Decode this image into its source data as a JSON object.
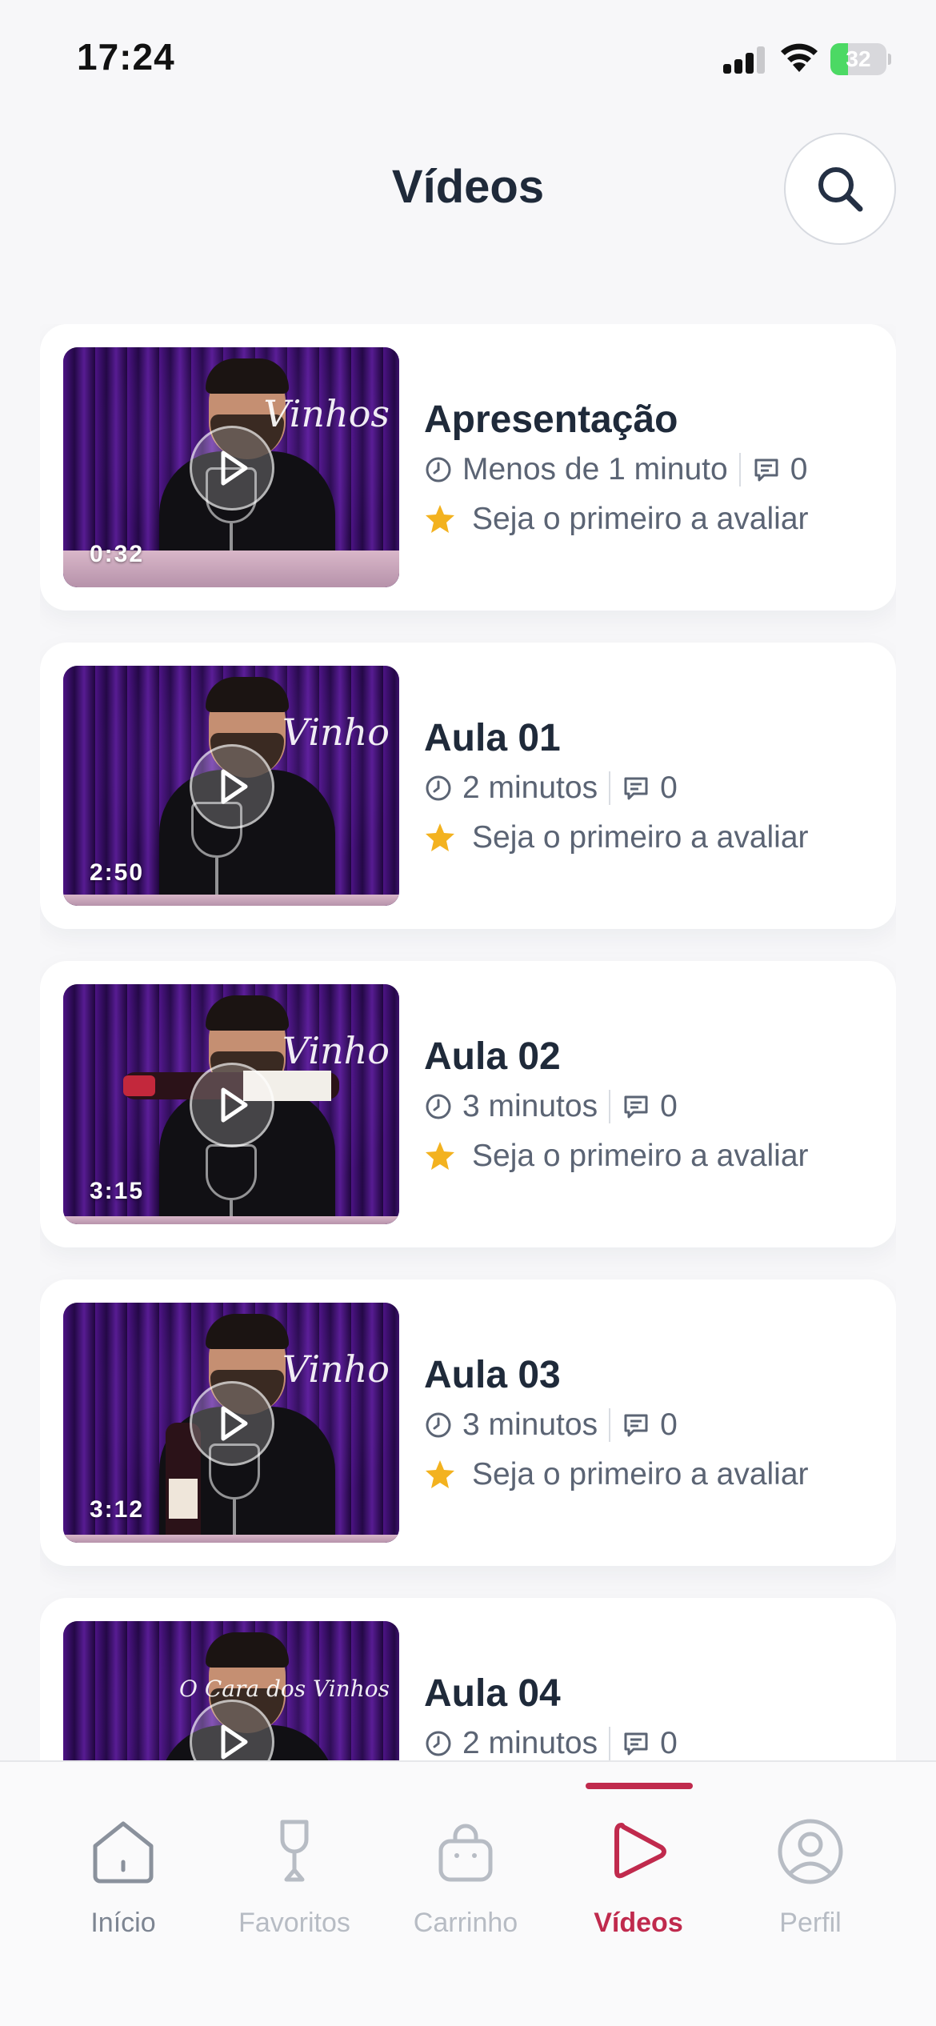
{
  "status_bar": {
    "time": "17:24",
    "battery_level": "32",
    "battery_fill_percent": 32
  },
  "header": {
    "title": "Vídeos",
    "search_icon": "search-icon"
  },
  "videos": [
    {
      "title": "Apresentação",
      "duration": "0:32",
      "length_text": "Menos de 1 minuto",
      "comments": "0",
      "rating_text": "Seja o primeiro a avaliar",
      "brand": "Vinhos"
    },
    {
      "title": "Aula 01",
      "duration": "2:50",
      "length_text": "2 minutos",
      "comments": "0",
      "rating_text": "Seja o primeiro a avaliar",
      "brand": "Vinho"
    },
    {
      "title": "Aula 02",
      "duration": "3:15",
      "length_text": "3 minutos",
      "comments": "0",
      "rating_text": "Seja o primeiro a avaliar",
      "brand": "Vinho"
    },
    {
      "title": "Aula 03",
      "duration": "3:12",
      "length_text": "3 minutos",
      "comments": "0",
      "rating_text": "Seja o primeiro a avaliar",
      "brand": "Vinho"
    },
    {
      "title": "Aula 04",
      "duration": "",
      "length_text": "2 minutos",
      "comments": "0",
      "rating_text": "",
      "brand": "O Cara dos Vinhos"
    }
  ],
  "tab_bar": {
    "tabs": [
      {
        "label": "Início",
        "icon": "home-icon"
      },
      {
        "label": "Favoritos",
        "icon": "wine-glass-icon"
      },
      {
        "label": "Carrinho",
        "icon": "bag-icon"
      },
      {
        "label": "Vídeos",
        "icon": "play-icon",
        "active": true
      },
      {
        "label": "Perfil",
        "icon": "profile-icon"
      }
    ]
  },
  "colors": {
    "accent": "#c02a4d",
    "star": "#f3b21f",
    "text_primary": "#1f2a3a",
    "text_secondary": "#5b6474",
    "battery_green": "#4cd964"
  }
}
